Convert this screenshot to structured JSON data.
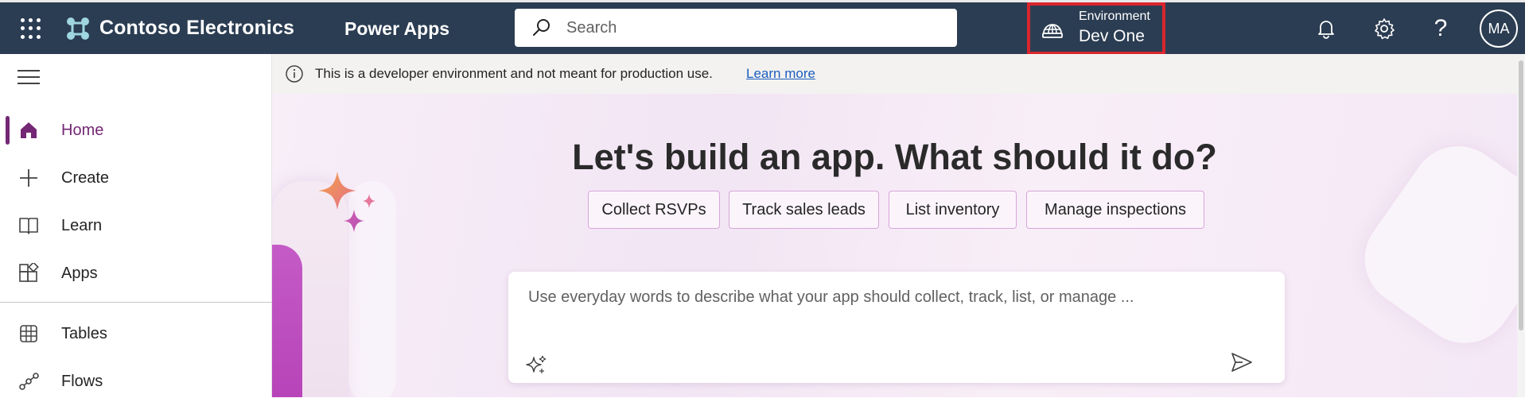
{
  "header": {
    "org_name": "Contoso Electronics",
    "app_name": "Power Apps",
    "search_placeholder": "Search",
    "environment_label": "Environment",
    "environment_value": "Dev One",
    "avatar_initials": "MA",
    "help_glyph": "?"
  },
  "sidebar": {
    "items": [
      {
        "label": "Home",
        "icon": "home-icon",
        "active": true
      },
      {
        "label": "Create",
        "icon": "plus-icon"
      },
      {
        "label": "Learn",
        "icon": "book-icon"
      },
      {
        "label": "Apps",
        "icon": "apps-icon"
      },
      {
        "label": "Tables",
        "icon": "table-icon"
      },
      {
        "label": "Flows",
        "icon": "flow-icon"
      }
    ]
  },
  "notice": {
    "text": "This is a developer environment and not meant for production use.",
    "link": "Learn more"
  },
  "hero": {
    "title": "Let's build an app. What should it do?",
    "suggestions": [
      "Collect RSVPs",
      "Track sales leads",
      "List inventory",
      "Manage inspections"
    ],
    "prompt_placeholder": "Use everyday words to describe what your app should collect, track, list, or manage ..."
  },
  "colors": {
    "header_bg": "#2b3d52",
    "accent": "#742774",
    "highlight_border": "#d9252d",
    "link": "#1a5dbe"
  }
}
